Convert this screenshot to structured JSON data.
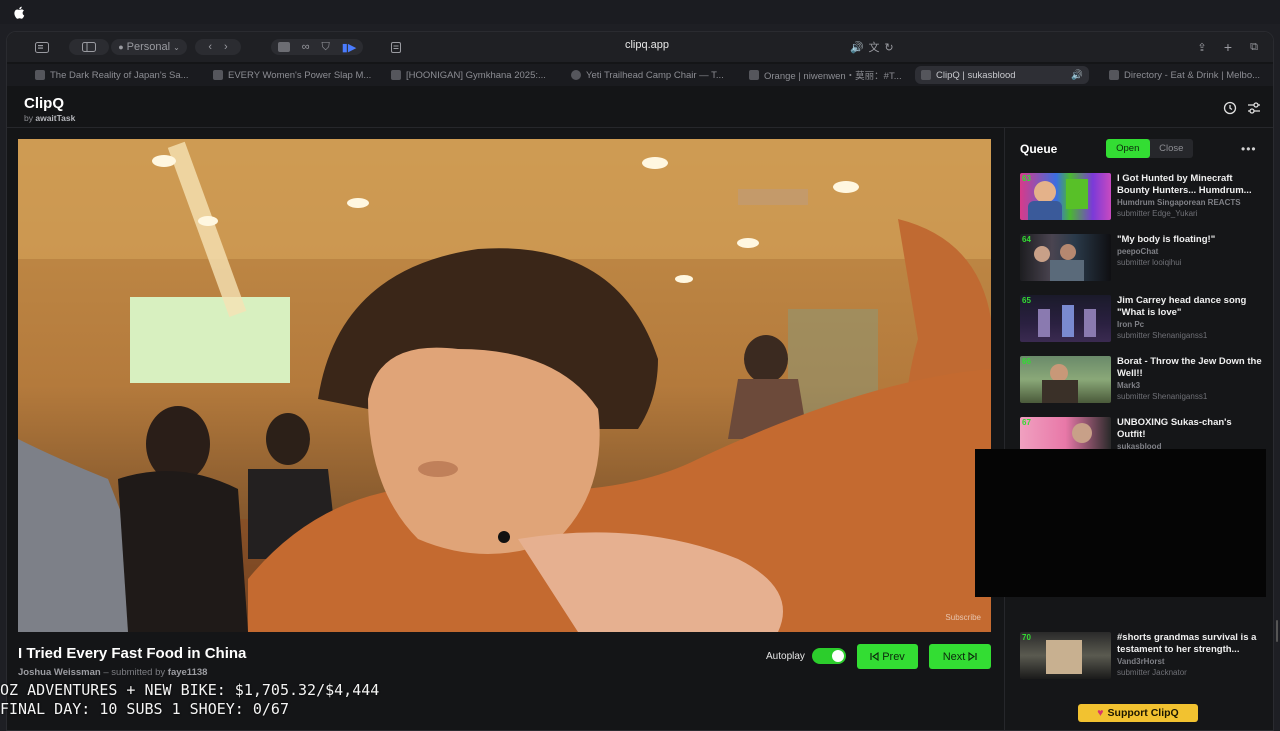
{
  "browser": {
    "profile_label": "Personal",
    "url": "clipq.app",
    "tabs": [
      {
        "title": "The Dark Reality of Japan's Sa..."
      },
      {
        "title": "EVERY Women's Power Slap M..."
      },
      {
        "title": "[HOONIGAN] Gymkhana 2025:..."
      },
      {
        "title": "Yeti Trailhead Camp Chair — T..."
      },
      {
        "title": "Orange | niwenwen・莫丽：#T..."
      },
      {
        "title": "ClipQ | sukasblood"
      },
      {
        "title": "Directory - Eat & Drink | Melbo..."
      }
    ]
  },
  "app": {
    "name": "ClipQ",
    "by_prefix": "by",
    "by_name": "awaitTask"
  },
  "video": {
    "title": "I Tried Every Fast Food in China",
    "author": "Joshua Weissman",
    "submitted_prefix": "– submitted by",
    "submitter": "faye1138",
    "watermark": "Subscribe"
  },
  "controls": {
    "autoplay_label": "Autoplay",
    "autoplay_on": true,
    "prev_label": "Prev",
    "next_label": "Next"
  },
  "queue": {
    "title": "Queue",
    "open_label": "Open",
    "close_label": "Close",
    "more_label": "•••",
    "items": [
      {
        "num": "63",
        "title": "I Got Hunted by Minecraft Bounty Hunters... Humdrum...",
        "channel": "Humdrum Singaporean REACTS",
        "submitter": "submitter Edge_Yukari"
      },
      {
        "num": "64",
        "title": "\"My body is floating!\"",
        "channel": "peepoChat",
        "submitter": "submitter looiqihui"
      },
      {
        "num": "65",
        "title": "Jim Carrey head dance song \"What is love\"",
        "channel": "Iron Pc",
        "submitter": "submitter Shenaniganss1"
      },
      {
        "num": "66",
        "title": "Borat - Throw the Jew Down the Well!!",
        "channel": "Mark3",
        "submitter": "submitter Shenaniganss1"
      },
      {
        "num": "67",
        "title": "UNBOXING Sukas-chan's Outfit!",
        "channel": "sukasblood",
        "submitter": ""
      },
      {
        "num": "70",
        "title": "#shorts grandmas survival is a testament to her strength...",
        "channel": "Vand3rHorst",
        "submitter": "submitter Jacknator"
      }
    ]
  },
  "overlay": {
    "line1": "OZ ADVENTURES + NEW BIKE: $1,705.32/$4,444",
    "line2": "FINAL DAY: 10 SUBS 1 SHOEY: 0/67"
  },
  "support_label": "Support ClipQ",
  "colors": {
    "accent_green": "#33dd33",
    "bg": "#141517",
    "support_yellow": "#f2c230"
  }
}
